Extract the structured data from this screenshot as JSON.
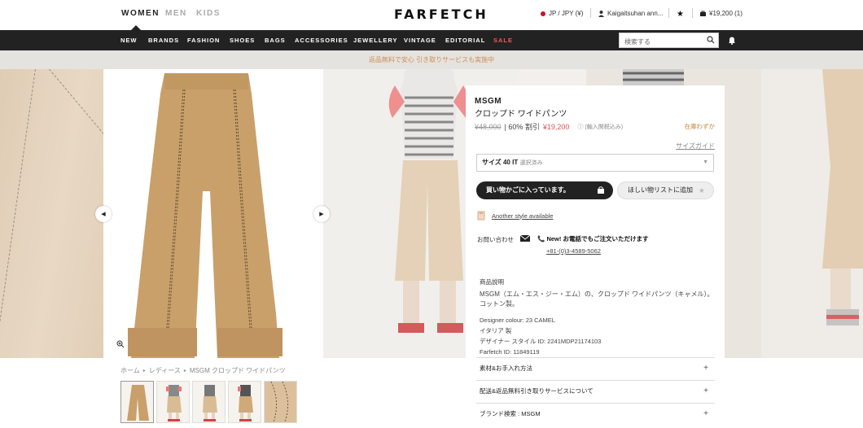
{
  "header": {
    "genders": [
      "WOMEN",
      "MEN",
      "KIDS"
    ],
    "active_gender": "WOMEN",
    "logo": "FARFETCH",
    "region": "JP / JPY (¥)",
    "account": "Kaigaitsuhan ann...",
    "cart": "¥19,200 (1)"
  },
  "nav": {
    "items": [
      "NEW",
      "BRANDS",
      "FASHION",
      "SHOES",
      "BAGS",
      "ACCESSORIES",
      "JEWELLERY",
      "VINTAGE",
      "EDITORIAL",
      "SALE"
    ],
    "search_placeholder": "検索する"
  },
  "banner": {
    "text": "返品無料で安心 引き取りサービスも実施中"
  },
  "breadcrumb": [
    "ホーム",
    "レディース",
    "MSGM クロップド ワイドパンツ"
  ],
  "product": {
    "brand": "MSGM",
    "name": "クロップド ワイドパンツ",
    "original_price": "¥48,000",
    "discount": "| 60% 割引",
    "sale_price": "¥19,200",
    "tax_note": "(輸入関税込み)",
    "stock_note": "在庫わずか",
    "size_guide": "サイズガイド",
    "size_label": "サイズ 40 IT",
    "size_status": "選択済み",
    "cart_button": "買い物かごに入っています。",
    "wishlist_button": "ほしい物リストに追加",
    "another_style": "Another style available",
    "contact_label": "お問い合わせ",
    "contact_new": "New! お電話でもご注文いただけます",
    "contact_tel": "+81-(0)3-4589-5062",
    "description_title": "商品説明",
    "description": "MSGM（エム・エス・ジー・エム）の、クロップド ワイドパンツ（キャメル）。コットン製。",
    "designer_colour": "Designer colour: 23 CAMEL",
    "origin": "イタリア 製",
    "style_id": "デザイナー スタイル ID: 2241MDP21174103",
    "farfetch_id": "Farfetch ID: 11849119",
    "accordions": [
      "素材&お手入れ方法",
      "配送&返品無料引き取りサービスについて",
      "ブランド検索 : MSGM"
    ]
  },
  "colors": {
    "accent_red": "#d45a5a",
    "stock_orange": "#c8863a",
    "pants_camel": "#c9a06a"
  },
  "icons": [
    "search-icon",
    "bell-icon",
    "star-icon",
    "bag-icon",
    "user-icon",
    "mail-icon",
    "phone-icon",
    "zoom-icon",
    "chevron-left-icon",
    "chevron-right-icon",
    "plus-icon"
  ]
}
